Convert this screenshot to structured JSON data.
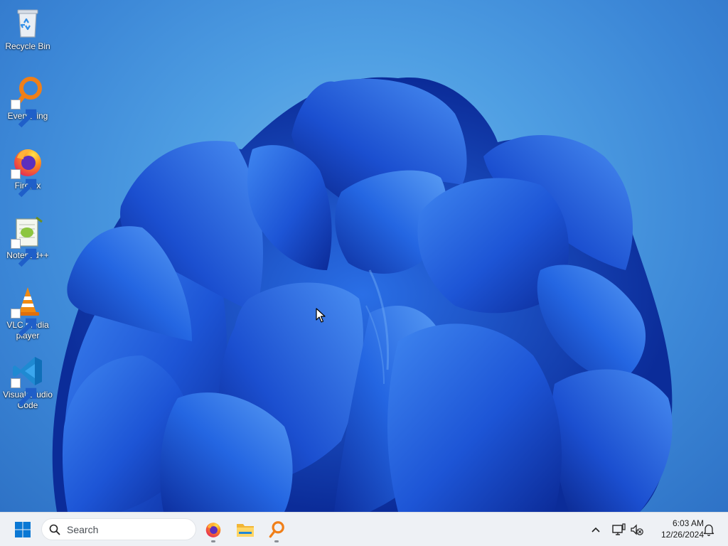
{
  "desktop": {
    "icons": [
      {
        "label": "Recycle Bin",
        "icon": "recycle-bin-icon"
      },
      {
        "label": "Everything",
        "icon": "everything-search-icon"
      },
      {
        "label": "Firefox",
        "icon": "firefox-icon"
      },
      {
        "label": "Notepad++",
        "icon": "notepad-plus-plus-icon"
      },
      {
        "label": "VLC media player",
        "icon": "vlc-cone-icon"
      },
      {
        "label": "Visual Studio Code",
        "icon": "vscode-icon"
      }
    ]
  },
  "taskbar": {
    "start_icon": "windows-start-icon",
    "search_placeholder": "Search",
    "pinned": [
      {
        "icon": "firefox-icon",
        "running": true
      },
      {
        "icon": "file-explorer-icon",
        "running": false
      },
      {
        "icon": "everything-search-icon",
        "running": true
      }
    ],
    "tray": {
      "show_hidden_icon": "chevron-up-icon",
      "network_icon": "network-icon",
      "volume_icon": "volume-muted-icon",
      "time": "6:03 AM",
      "date": "12/26/2024",
      "notification_icon": "bell-icon"
    }
  },
  "colors": {
    "wallpaper_bg": "#4f9fe3",
    "bloom_dark": "#0a2a9c",
    "bloom_mid": "#1f5fe0",
    "taskbar_bg": "#eef1f5",
    "start_blue": "#0a78d4"
  }
}
